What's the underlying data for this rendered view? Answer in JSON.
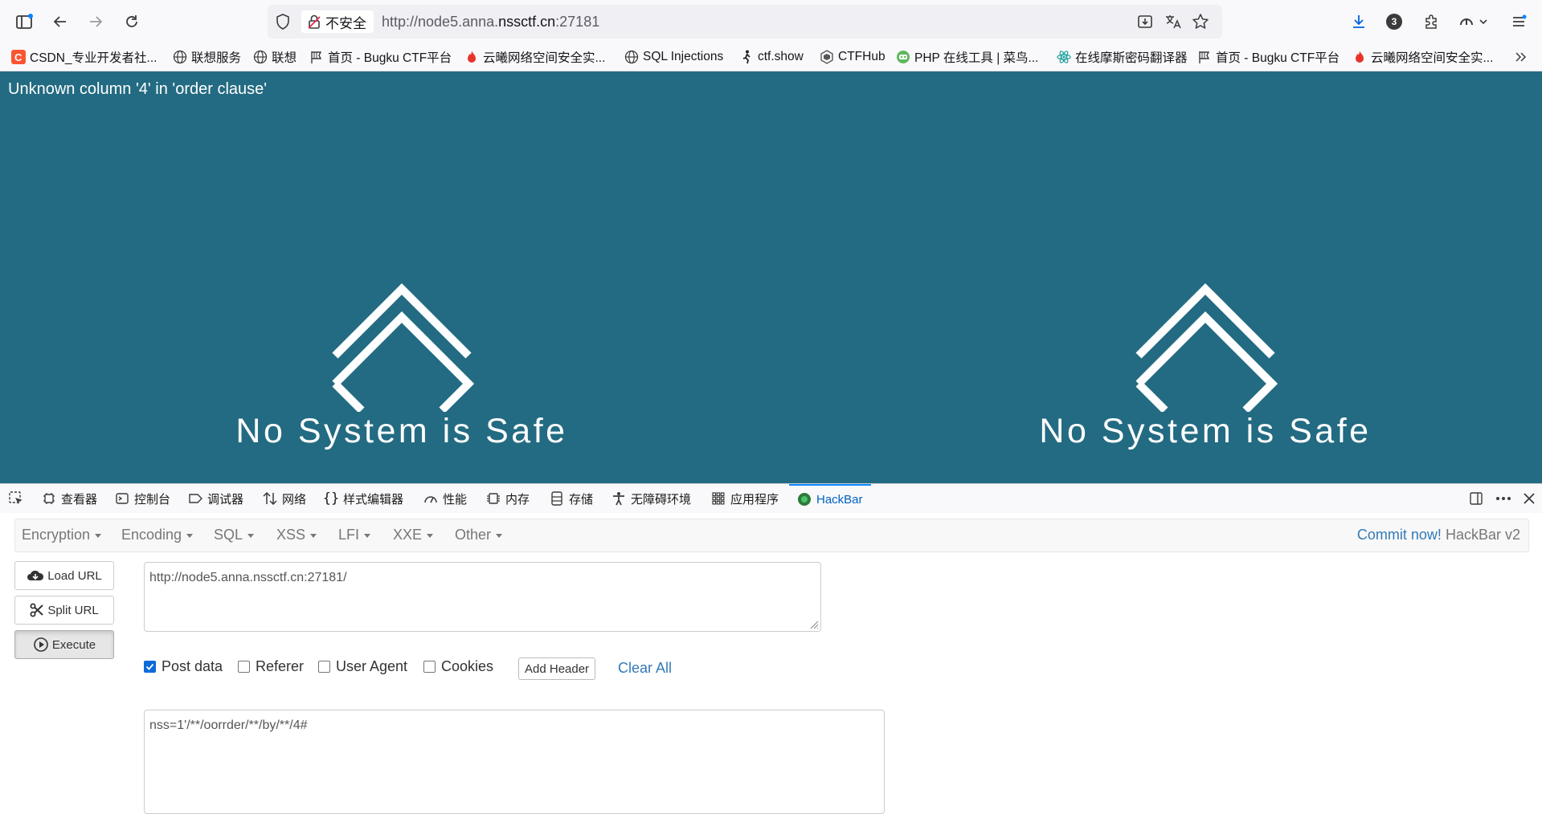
{
  "browser": {
    "security_label": "不安全",
    "url_prefix": "http://node5.anna.",
    "url_domain": "nssctf.cn",
    "url_suffix": ":27181",
    "extensions_badge": "3"
  },
  "bookmarks": [
    {
      "label": "CSDN_专业开发者社...",
      "icon": "csdn-icon"
    },
    {
      "label": "联想服务",
      "icon": "globe-icon"
    },
    {
      "label": "联想",
      "icon": "globe-icon"
    },
    {
      "label": "首页 - Bugku CTF平台",
      "icon": "flag-icon"
    },
    {
      "label": "云曦网络空间安全实...",
      "icon": "flame-icon"
    },
    {
      "label": "SQL Injections",
      "icon": "globe-icon"
    },
    {
      "label": "ctf.show",
      "icon": "runner-icon"
    },
    {
      "label": "CTFHub",
      "icon": "ctfhub-icon"
    },
    {
      "label": "PHP 在线工具 | 菜鸟...",
      "icon": "runoob-icon"
    },
    {
      "label": "在线摩斯密码翻译器",
      "icon": "atom-icon"
    },
    {
      "label": "首页 - Bugku CTF平台",
      "icon": "flag-icon"
    },
    {
      "label": "云曦网络空间安全实...",
      "icon": "flame-icon"
    }
  ],
  "page": {
    "error_message": "Unknown column '4' in 'order clause'",
    "logo_text": "No System is Safe"
  },
  "devtools": {
    "tabs": [
      {
        "label": "查看器",
        "icon": "inspector-icon"
      },
      {
        "label": "控制台",
        "icon": "console-icon"
      },
      {
        "label": "调试器",
        "icon": "debugger-icon"
      },
      {
        "label": "网络",
        "icon": "network-icon"
      },
      {
        "label": "样式编辑器",
        "icon": "style-editor-icon"
      },
      {
        "label": "性能",
        "icon": "performance-icon"
      },
      {
        "label": "内存",
        "icon": "memory-icon"
      },
      {
        "label": "存储",
        "icon": "storage-icon"
      },
      {
        "label": "无障碍环境",
        "icon": "accessibility-icon"
      },
      {
        "label": "应用程序",
        "icon": "application-icon"
      },
      {
        "label": "HackBar",
        "icon": "hackbar-icon"
      }
    ],
    "active_tab": "HackBar"
  },
  "hackbar": {
    "menus": [
      "Encryption",
      "Encoding",
      "SQL",
      "XSS",
      "LFI",
      "XXE",
      "Other"
    ],
    "commit_link": "Commit now!",
    "version": "HackBar v2",
    "buttons": {
      "load_url": "Load URL",
      "split_url": "Split URL",
      "execute": "Execute"
    },
    "url_value": "http://node5.anna.nssctf.cn:27181/",
    "options": {
      "post_data": "Post data",
      "referer": "Referer",
      "user_agent": "User Agent",
      "cookies": "Cookies"
    },
    "add_header": "Add Header",
    "clear_all": "Clear All",
    "post_body": "nss=1'/**/oorrder/**/by/**/4#",
    "accent_color": "#337ab7"
  },
  "colors": {
    "page_background": "#236b82",
    "link_blue": "#0061c2"
  }
}
